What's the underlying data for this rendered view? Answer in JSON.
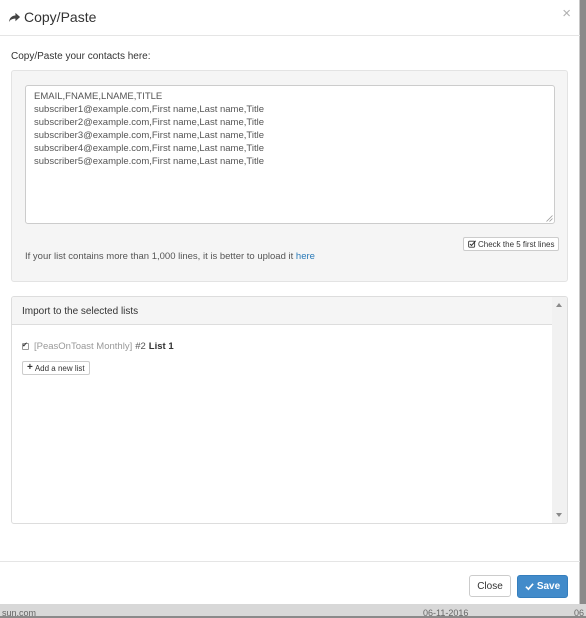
{
  "modal": {
    "title": "Copy/Paste",
    "title_icon": "share-arrow-icon",
    "close_glyph": "×"
  },
  "import": {
    "label": "Copy/Paste your contacts here:",
    "textarea_value": "EMAIL,FNAME,LNAME,TITLE\nsubscriber1@example.com,First name,Last name,Title\nsubscriber2@example.com,First name,Last name,Title\nsubscriber3@example.com,First name,Last name,Title\nsubscriber4@example.com,First name,Last name,Title\nsubscriber5@example.com,First name,Last name,Title",
    "check_button_label": "Check the 5 first lines",
    "upload_hint": "If your list contains more than 1,000 lines, it is better to upload it",
    "upload_link": "here"
  },
  "lists_panel": {
    "heading": "Import to the selected lists",
    "lists": [
      {
        "prefix": "[PeasOnToast Monthly]",
        "number": "#2",
        "name": "List 1",
        "checked": true
      }
    ],
    "add_button_label": "Add a new list"
  },
  "footer": {
    "close_label": "Close",
    "save_label": "Save"
  },
  "background": {
    "left_snippet": "sun.com",
    "right_snippet": "06-11-2016",
    "far_right_snippet": "06"
  },
  "colors": {
    "primary": "#428bca",
    "link": "#2a7ab8",
    "well": "#f5f5f5",
    "muted_text": "#999999"
  }
}
